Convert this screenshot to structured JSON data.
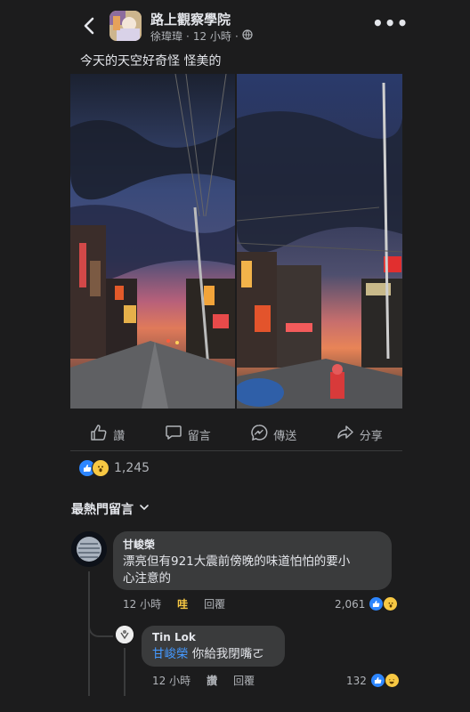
{
  "header": {
    "group_name": "路上觀察學院",
    "author": "徐瑋瑋",
    "separator": "·",
    "time": "12 小時",
    "privacy_icon": "globe-icon",
    "more_label": "•••"
  },
  "post": {
    "caption": "今天的天空好奇怪 怪美的",
    "actions": [
      {
        "label": "讚",
        "icon": "thumbs-up-icon"
      },
      {
        "label": "留言",
        "icon": "comment-icon"
      },
      {
        "label": "傳送",
        "icon": "messenger-icon"
      },
      {
        "label": "分享",
        "icon": "share-icon"
      }
    ],
    "reaction_count": "1,245"
  },
  "comments": {
    "sort_label": "最熱門留言",
    "items": [
      {
        "name": "甘峻榮",
        "text_line1": "漂亮但有921大震前傍晚的味道怕怕的要小",
        "text_line2": "心注意的",
        "time": "12 小時",
        "reaction_label": "哇",
        "reply_label": "回覆",
        "count": "2,061"
      }
    ],
    "replies": [
      {
        "name": "Tin Lok",
        "mention": "甘峻榮",
        "text": " 你給我閉嘴ㄛ",
        "time": "12 小時",
        "like_label": "讚",
        "reply_label": "回覆",
        "count": "132"
      }
    ]
  },
  "colors": {
    "background": "#1c1c1d",
    "bubble": "#3a3b3c",
    "accent": "#2d86ff",
    "wow": "#f7c843",
    "link": "#4599ff"
  }
}
